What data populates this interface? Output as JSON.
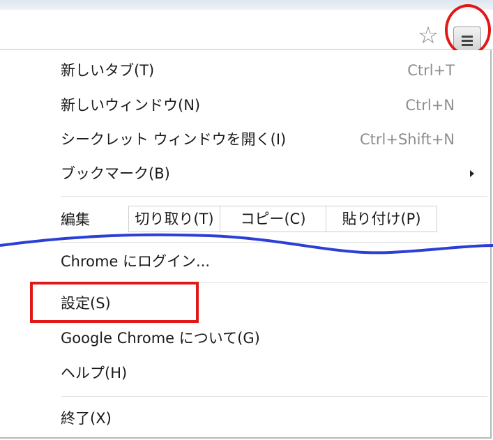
{
  "toolbar": {
    "star_icon": "star-outline",
    "menu_icon": "hamburger-menu"
  },
  "menu": {
    "new_tab": {
      "label": "新しいタブ(T)",
      "shortcut": "Ctrl+T"
    },
    "new_window": {
      "label": "新しいウィンドウ(N)",
      "shortcut": "Ctrl+N"
    },
    "incognito": {
      "label": "シークレット ウィンドウを開く(I)",
      "shortcut": "Ctrl+Shift+N"
    },
    "bookmarks": {
      "label": "ブックマーク(B)"
    },
    "edit": {
      "label": "編集",
      "cut": "切り取り(T)",
      "copy": "コピー(C)",
      "paste": "貼り付け(P)"
    },
    "sign_in": {
      "label": "Chrome にログイン..."
    },
    "settings": {
      "label": "設定(S)"
    },
    "about": {
      "label": "Google Chrome について(G)"
    },
    "help": {
      "label": "ヘルプ(H)"
    },
    "exit": {
      "label": "終了(X)"
    }
  },
  "annotations": {
    "highlight_color": "#e01818",
    "wave_color": "#2b3fd6"
  }
}
